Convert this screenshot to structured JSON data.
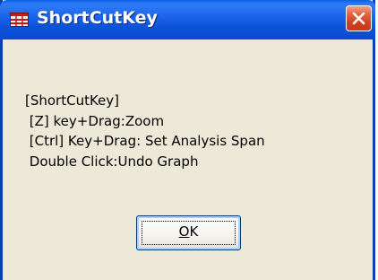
{
  "window": {
    "title": "ShortCutKey",
    "icon": "app-grid-icon",
    "close_icon": "close-icon"
  },
  "message": {
    "lines": [
      "[ShortCutKey]",
      " [Z] key+Drag:Zoom",
      " [Ctrl] Key+Drag: Set Analysis Span",
      " Double Click:Undo Graph"
    ]
  },
  "buttons": {
    "ok": {
      "mnemonic": "O",
      "rest": "K"
    }
  },
  "colors": {
    "titlebar": "#0a4bd0",
    "dialog_bg": "#ece9d8",
    "close_button": "#d0401f"
  }
}
